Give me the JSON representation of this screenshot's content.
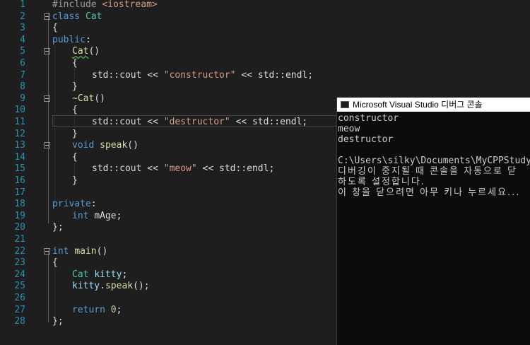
{
  "editor": {
    "line_numbers": [
      "1",
      "2",
      "3",
      "4",
      "5",
      "6",
      "7",
      "8",
      "9",
      "10",
      "11",
      "12",
      "13",
      "14",
      "15",
      "16",
      "17",
      "18",
      "19",
      "20",
      "21",
      "22",
      "23",
      "24",
      "25",
      "26",
      "27",
      "28"
    ],
    "line1": {
      "pp": "#include ",
      "inc": "<iostream>"
    },
    "line2": {
      "kw": "class",
      "sp": " ",
      "ty": "Cat"
    },
    "line3": {
      "t": "{"
    },
    "line4": {
      "kw": "public",
      "p": ":"
    },
    "line5": {
      "fn": "Cat",
      "p": "()"
    },
    "line6": {
      "t": "{"
    },
    "line7": {
      "a": "std::cout << ",
      "s": "\"constructor\"",
      "b": " << std::endl;"
    },
    "line8": {
      "t": "}"
    },
    "line9": {
      "fn": "~Cat",
      "p": "()"
    },
    "line10": {
      "t": "{"
    },
    "line11": {
      "a": "std::cout << ",
      "s": "\"destructor\"",
      "b": " << std::endl;"
    },
    "line12": {
      "t": "}"
    },
    "line13": {
      "kw": "void",
      "sp": " ",
      "fn": "speak",
      "p": "()"
    },
    "line14": {
      "t": "{"
    },
    "line15": {
      "a": "std::cout << ",
      "s": "\"meow\"",
      "b": " << std::endl;"
    },
    "line16": {
      "t": "}"
    },
    "line18": {
      "kw": "private",
      "p": ":"
    },
    "line19": {
      "kw": "int",
      "sp": " ",
      "v": "mAge",
      "p": ";"
    },
    "line20": {
      "t": "};"
    },
    "line22": {
      "kw": "int",
      "sp": " ",
      "fn": "main",
      "p": "()"
    },
    "line23": {
      "t": "{"
    },
    "line24": {
      "ty": "Cat",
      "sp": " ",
      "v": "kitty",
      "p": ";"
    },
    "line25": {
      "v": "kitty",
      "dot": ".",
      "fn": "speak",
      "p": "();"
    },
    "line27": {
      "kw": "return",
      "sp": " ",
      "n": "0",
      "p": ";"
    },
    "line28": {
      "t": "};"
    }
  },
  "console": {
    "title": "Microsoft Visual Studio 디버그 콘솔",
    "lines": [
      "constructor",
      "meow",
      "destructor",
      "",
      "C:\\Users\\silky\\Documents\\MyCPPStudy\\",
      "디버깅이 중지될 때 콘솔을 자동으로 닫",
      "하도록 설정합니다.",
      "이 창을 닫으려면 아무 키나 누르세요..."
    ]
  },
  "colors": {
    "background": "#1e1e1e",
    "keyword": "#569cd6",
    "type": "#4ec9b0",
    "function": "#dcdcaa",
    "string": "#d69d85",
    "line_number": "#2b91af"
  }
}
